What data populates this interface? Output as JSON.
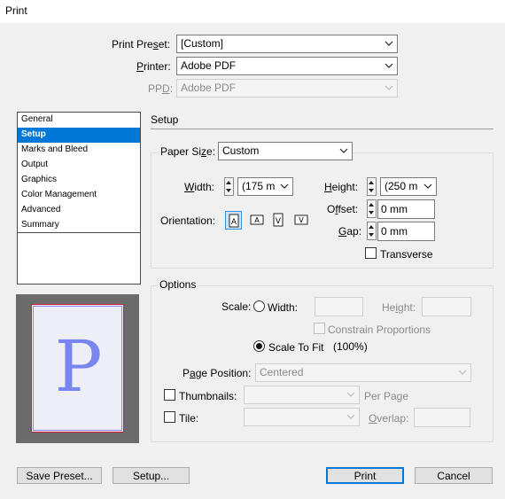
{
  "window": {
    "title": "Print"
  },
  "top": {
    "print_preset_label_pre": "Print Pre",
    "print_preset_label_u": "s",
    "print_preset_label_post": "et:",
    "print_preset_value": "[Custom]",
    "printer_label_u": "P",
    "printer_label_post": "rinter:",
    "printer_value": "Adobe PDF",
    "ppd_label_pre": "PP",
    "ppd_label_u": "D",
    "ppd_label_post": ":",
    "ppd_value": "Adobe PDF"
  },
  "sidebar": {
    "items": [
      {
        "label": "General"
      },
      {
        "label": "Setup"
      },
      {
        "label": "Marks and Bleed"
      },
      {
        "label": "Output"
      },
      {
        "label": "Graphics"
      },
      {
        "label": "Color Management"
      },
      {
        "label": "Advanced"
      },
      {
        "label": "Summary"
      }
    ],
    "selected": "Setup"
  },
  "preview": {
    "letter": "P"
  },
  "setup": {
    "heading": "Setup",
    "paper_size_label_pre": "Paper Si",
    "paper_size_label_u": "z",
    "paper_size_label_post": "e:",
    "paper_size_value": "Custom",
    "width_label_u": "W",
    "width_label_post": "idth:",
    "width_value": "(175 m",
    "height_label_u": "H",
    "height_label_post": "eight:",
    "height_value": "(250 m",
    "offset_label_pre": "O",
    "offset_label_u": "f",
    "offset_label_post": "fset:",
    "offset_value": "0 mm",
    "gap_label_u": "G",
    "gap_label_post": "ap:",
    "gap_value": "0 mm",
    "orientation_label": "Orientation:",
    "transverse_label": "Transverse"
  },
  "options": {
    "title": "Options",
    "scale_label": "Scale:",
    "width_label": "Width:",
    "height_label_pre": "He",
    "height_label_u": "i",
    "height_label_post": "ght:",
    "constrain_label": "Constrain Proportions",
    "scale_to_fit_label": "Scale To Fit",
    "scale_to_fit_value": "(100%)",
    "page_position_label_pre": "P",
    "page_position_label_u": "a",
    "page_position_label_post": "ge Position:",
    "page_position_value": "Centered",
    "thumbnails_label": "Thumbnails:",
    "per_page_label": "Per Page",
    "tile_label": "Tile:",
    "overlap_label_u": "O",
    "overlap_label_post": "verlap:"
  },
  "buttons": {
    "save_preset": "Save Preset...",
    "setup": "Setup...",
    "print": "Print",
    "cancel": "Cancel"
  },
  "colors": {
    "selection": "#0078d7",
    "preview_bg": "#6b6b6b",
    "preview_letter": "#7a86f0"
  }
}
